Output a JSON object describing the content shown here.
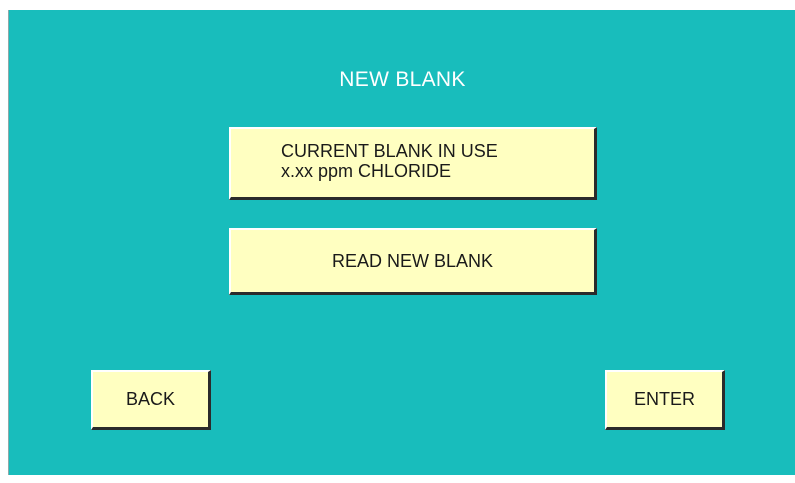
{
  "screen": {
    "title": "NEW BLANK",
    "background_color": "#18BDBC",
    "button_color": "#FFFFC1"
  },
  "current_blank": {
    "line1": "CURRENT BLANK IN USE",
    "line2": "x.xx ppm CHLORIDE"
  },
  "buttons": {
    "read_new_blank": "READ NEW BLANK",
    "back": "BACK",
    "enter": "ENTER"
  }
}
